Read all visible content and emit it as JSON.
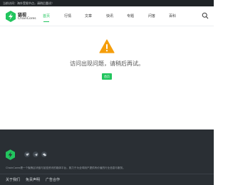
{
  "topbar": {
    "text": "当前访问：海外受限节点，请稍后重试！",
    "right": ""
  },
  "brand": {
    "name_cn": "链视",
    "name_en": "ChainCores",
    "accent": "#22c55e"
  },
  "nav": {
    "items": [
      {
        "label": "首页",
        "active": true
      },
      {
        "label": "行情"
      },
      {
        "label": "文章"
      },
      {
        "label": "快讯"
      },
      {
        "label": "专题"
      },
      {
        "label": "问答"
      },
      {
        "label": "百科"
      }
    ]
  },
  "error": {
    "message": "访问出现问题，请稍后再试。",
    "button_label": "首页"
  },
  "footer": {
    "description": "ChainCores是一个聚焦区块链与加密资讯的媒体平台，致力于为全球用户提供有价值的行业信息与服务。",
    "links": [
      "关于我们",
      "免责声明",
      "广告合作"
    ]
  }
}
